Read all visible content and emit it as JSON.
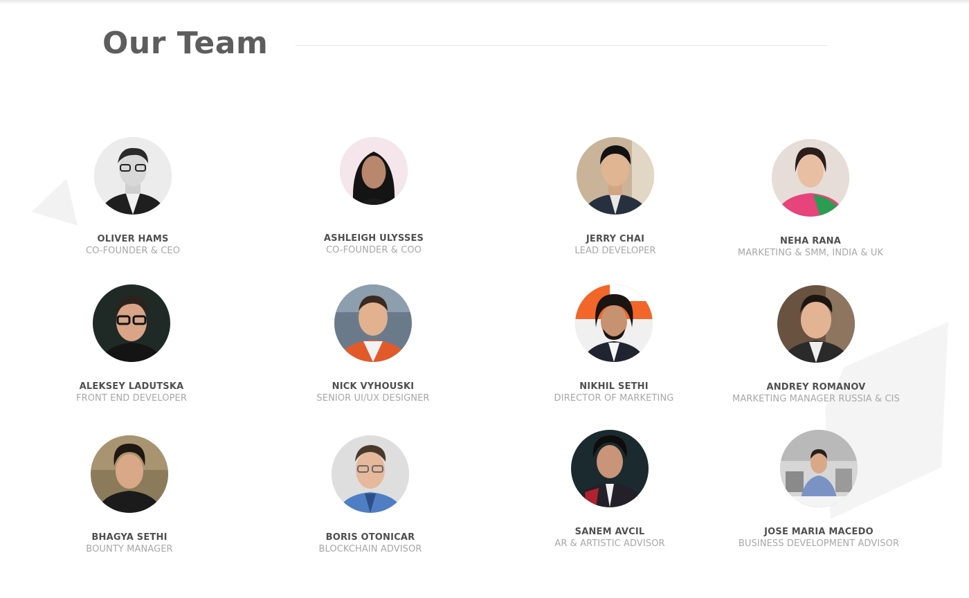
{
  "section": {
    "title": "Our Team"
  },
  "team": [
    {
      "name": "OLIVER HAMS",
      "role": "CO-FOUNDER & CEO"
    },
    {
      "name": "ASHLEIGH ULYSSES",
      "role": "CO-FOUNDER & COO"
    },
    {
      "name": "JERRY CHAI",
      "role": "LEAD DEVELOPER"
    },
    {
      "name": "NEHA RANA",
      "role": "MARKETING & SMM, INDIA & UK"
    },
    {
      "name": "ALEKSEY LADUTSKA",
      "role": "FRONT END DEVELOPER"
    },
    {
      "name": "NICK VYHOUSKI",
      "role": "SENIOR UI/UX DESIGNER"
    },
    {
      "name": "NIKHIL SETHI",
      "role": "DIRECTOR OF MARKETING"
    },
    {
      "name": "ANDREY ROMANOV",
      "role": "MARKETING MANAGER RUSSIA & CIS"
    },
    {
      "name": "BHAGYA SETHI",
      "role": "BOUNTY MANAGER"
    },
    {
      "name": "BORIS OTONICAR",
      "role": "BLOCKCHAIN ADVISOR"
    },
    {
      "name": "SANEM AVCIL",
      "role": "AR & ARTISTIC ADVISOR"
    },
    {
      "name": "JOSE MARIA MACEDO",
      "role": "BUSINESS DEVELOPMENT ADVISOR"
    }
  ],
  "colors": {
    "title": "#5d5d5d",
    "name": "#4f4f4f",
    "role": "#a7a7a7",
    "rule": "#e4e4e4",
    "decoration": "#f2f2f2"
  }
}
